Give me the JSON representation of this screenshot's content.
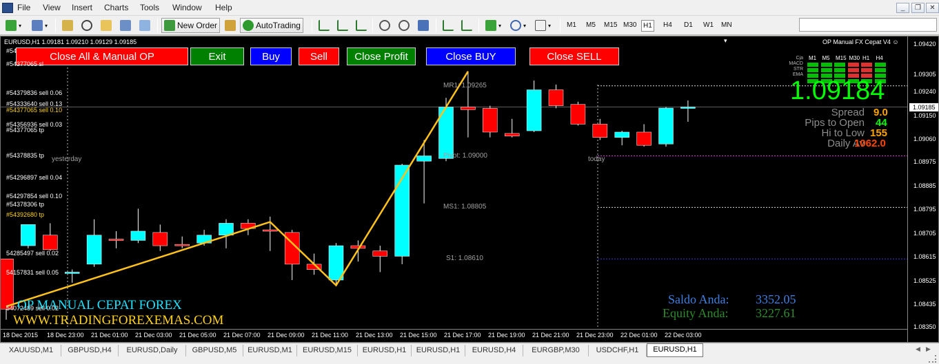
{
  "menu": [
    "File",
    "View",
    "Insert",
    "Charts",
    "Tools",
    "Window",
    "Help"
  ],
  "toolbar": {
    "new_order_label": "New Order",
    "autotrading_label": "AutoTrading",
    "timeframes": [
      "M1",
      "M5",
      "M15",
      "M30",
      "H1",
      "H4",
      "D1",
      "W1",
      "MN"
    ],
    "active_timeframe": "H1"
  },
  "chart": {
    "title": "EURUSD,H1  1.09181 1.09210 1.09129 1.09185",
    "indicator_name": "OP Manual FX Cepat V4",
    "buttons": [
      {
        "label": "Close All & Manual OP",
        "color": "#ff0000"
      },
      {
        "label": "Exit",
        "color": "#008000"
      },
      {
        "label": "Buy",
        "color": "#0000ff"
      },
      {
        "label": "Sell",
        "color": "#ff0000"
      },
      {
        "label": "Close Profit",
        "color": "#008000"
      },
      {
        "label": "Close BUY",
        "color": "#0000ff"
      },
      {
        "label": "Close SELL",
        "color": "#ff0000"
      }
    ],
    "order_labels": [
      {
        "text": "#54",
        "y": 1.09395,
        "yellow": false
      },
      {
        "text": "#54377065 sl",
        "y": 1.09345,
        "yellow": false
      },
      {
        "text": "#54379836 sell 0.06",
        "y": 1.09235,
        "yellow": false
      },
      {
        "text": "#54333640 sell 0.13",
        "y": 1.09195,
        "yellow": false
      },
      {
        "text": "#54377065 sell 0.10",
        "y": 1.0917,
        "yellow": true
      },
      {
        "text": "#54356936 sell 0.03",
        "y": 1.09115,
        "yellow": false
      },
      {
        "text": "#54377065 tp",
        "y": 1.09095,
        "yellow": false
      },
      {
        "text": "#54378835 tp",
        "y": 1.08998,
        "yellow": false
      },
      {
        "text": "#54296897 sell 0.04",
        "y": 1.08915,
        "yellow": false
      },
      {
        "text": "#54297854 sell 0.10",
        "y": 1.08845,
        "yellow": false
      },
      {
        "text": "#54378306 tp",
        "y": 1.08815,
        "yellow": false
      },
      {
        "text": "#54392680 tp",
        "y": 1.08775,
        "yellow": true
      },
      {
        "text": "54285497 sell 0.02",
        "y": 1.0863,
        "yellow": false
      },
      {
        "text": "54157831 sell 0.05",
        "y": 1.08555,
        "yellow": false
      },
      {
        "text": "54072489 sell 0.02",
        "y": 1.0842,
        "yellow": false
      }
    ],
    "pivot_labels": [
      {
        "text": "MR1: 1.09265",
        "y": 1.09265
      },
      {
        "text": "Pivot: 1.09000",
        "y": 1.09
      },
      {
        "text": "MS1: 1.08805",
        "y": 1.08805
      },
      {
        "text": "S1: 1.08610",
        "y": 1.0861
      }
    ],
    "session_labels": [
      {
        "text": "yesterday",
        "y": 1.08985
      },
      {
        "text": "today",
        "y": 1.08985
      }
    ],
    "signal_table": {
      "columns": [
        "M1",
        "M5",
        "M15",
        "M30",
        "H1",
        "H4"
      ],
      "rows": [
        "Cja",
        "MACD",
        "STR",
        "EMA"
      ],
      "header_label": "Cja",
      "cell_colors": [
        [
          "#00c000",
          "#00c000",
          "#00c000",
          "#e03030",
          "#e03030",
          "#00c000"
        ],
        [
          "#00c000",
          "#00c000",
          "#00c000",
          "#e03030",
          "#e03030",
          "#00c000"
        ],
        [
          "#00c000",
          "#00c000",
          "#00c000",
          "#e03030",
          "#e03030",
          "#00c000"
        ],
        [
          "#00c000",
          "#00c000",
          "#00c000",
          "#00c000",
          "#00c000",
          "#00c000"
        ]
      ]
    },
    "big_price": "1.09184",
    "stats": [
      {
        "label": "Spread",
        "value": "9.0",
        "color": "#ffa500"
      },
      {
        "label": "Pips to Open",
        "value": "44",
        "color": "#00ff00"
      },
      {
        "label": "Hi to Low",
        "value": "155",
        "color": "#ffa500"
      },
      {
        "label": "Daily Av",
        "value": "1062.0",
        "color": "#ff4500"
      }
    ],
    "account": {
      "saldo_label": "Saldo Anda:",
      "saldo_value": "3352.05",
      "equity_label": "Equity Anda:",
      "equity_value": "3227.61"
    },
    "brand_line1": "OP MANUAL CEPAT FOREX",
    "brand_line2": "WWW.TRADINGFOREXEMAS.COM",
    "price_axis": [
      "1.09420",
      "1.09305",
      "1.09240",
      "1.09150",
      "1.09060",
      "1.08975",
      "1.08885",
      "1.08795",
      "1.08705",
      "1.08615",
      "1.08525",
      "1.08435",
      "1.08350"
    ],
    "current_price_axis": "1.09185",
    "time_axis": [
      "18 Dec 2015",
      "18 Dec 23:00",
      "21 Dec 01:00",
      "21 Dec 03:00",
      "21 Dec 05:00",
      "21 Dec 07:00",
      "21 Dec 09:00",
      "21 Dec 11:00",
      "21 Dec 13:00",
      "21 Dec 15:00",
      "21 Dec 17:00",
      "21 Dec 19:00",
      "21 Dec 21:00",
      "21 Dec 23:00",
      "22 Dec 01:00",
      "22 Dec 03:00"
    ]
  },
  "chart_data": {
    "type": "candlestick",
    "ylim": [
      1.08345,
      1.09452
    ],
    "candles": [
      {
        "o": 1.0861,
        "h": 1.0861,
        "c": 1.0842,
        "l": 1.0838
      },
      {
        "o": 1.0866,
        "h": 1.087,
        "c": 1.0874,
        "l": 1.0865
      },
      {
        "o": 1.087,
        "h": 1.08745,
        "c": 1.08645,
        "l": 1.0864
      },
      {
        "o": 1.0856,
        "h": 1.0857,
        "c": 1.0856,
        "l": 1.0852
      },
      {
        "o": 1.0859,
        "h": 1.0876,
        "c": 1.087,
        "l": 1.0858
      },
      {
        "o": 1.08685,
        "h": 1.08715,
        "c": 1.0868,
        "l": 1.0865
      },
      {
        "o": 1.0868,
        "h": 1.088,
        "c": 1.08715,
        "l": 1.0867
      },
      {
        "o": 1.0871,
        "h": 1.0874,
        "c": 1.0866,
        "l": 1.0864
      },
      {
        "o": 1.08665,
        "h": 1.08695,
        "c": 1.0866,
        "l": 1.0865
      },
      {
        "o": 1.0867,
        "h": 1.0872,
        "c": 1.087,
        "l": 1.0866
      },
      {
        "o": 1.087,
        "h": 1.0876,
        "c": 1.08745,
        "l": 1.0865
      },
      {
        "o": 1.08745,
        "h": 1.0876,
        "c": 1.08725,
        "l": 1.087
      },
      {
        "o": 1.0872,
        "h": 1.0877,
        "c": 1.08715,
        "l": 1.0864
      },
      {
        "o": 1.0871,
        "h": 1.0872,
        "c": 1.0859,
        "l": 1.0853
      },
      {
        "o": 1.0859,
        "h": 1.0863,
        "c": 1.0857,
        "l": 1.0855
      },
      {
        "o": 1.0853,
        "h": 1.0867,
        "c": 1.0866,
        "l": 1.0851
      },
      {
        "o": 1.0866,
        "h": 1.0868,
        "c": 1.0865,
        "l": 1.086
      },
      {
        "o": 1.0864,
        "h": 1.0866,
        "c": 1.0862,
        "l": 1.0856
      },
      {
        "o": 1.0862,
        "h": 1.0897,
        "c": 1.08965,
        "l": 1.0859
      },
      {
        "o": 1.0898,
        "h": 1.0906,
        "c": 1.09,
        "l": 1.0882
      },
      {
        "o": 1.0899,
        "h": 1.0922,
        "c": 1.09185,
        "l": 1.0898
      },
      {
        "o": 1.09185,
        "h": 1.0932,
        "c": 1.09175,
        "l": 1.0907
      },
      {
        "o": 1.0918,
        "h": 1.0919,
        "c": 1.0909,
        "l": 1.0907
      },
      {
        "o": 1.09085,
        "h": 1.0914,
        "c": 1.09075,
        "l": 1.0907
      },
      {
        "o": 1.09095,
        "h": 1.09285,
        "c": 1.0925,
        "l": 1.0909
      },
      {
        "o": 1.0925,
        "h": 1.0927,
        "c": 1.0919,
        "l": 1.0918
      },
      {
        "o": 1.09195,
        "h": 1.09205,
        "c": 1.0912,
        "l": 1.09115
      },
      {
        "o": 1.0912,
        "h": 1.0914,
        "c": 1.0907,
        "l": 1.0906
      },
      {
        "o": 1.0907,
        "h": 1.09095,
        "c": 1.0909,
        "l": 1.0904
      },
      {
        "o": 1.0909,
        "h": 1.0912,
        "c": 1.0904,
        "l": 1.09035
      },
      {
        "o": 1.09045,
        "h": 1.09185,
        "c": 1.09181,
        "l": 1.09035
      },
      {
        "o": 1.09181,
        "h": 1.0921,
        "c": 1.09185,
        "l": 1.09129
      }
    ],
    "zigzag": [
      {
        "i": 0,
        "p": 1.0843
      },
      {
        "i": 12,
        "p": 1.0875
      },
      {
        "i": 15,
        "p": 1.0851
      },
      {
        "i": 21,
        "p": 1.0932
      }
    ]
  },
  "tabs": [
    "XAUUSD,M1",
    "GBPUSD,H4",
    "EURUSD,Daily",
    "GBPUSD,M5",
    "EURUSD,M1",
    "EURUSD,M15",
    "EURUSD,H1",
    "EURUSD,H1",
    "EURUSD,H4",
    "EURGBP,M30",
    "USDCHF,H1",
    "EURUSD,H1"
  ],
  "active_tab": 11
}
